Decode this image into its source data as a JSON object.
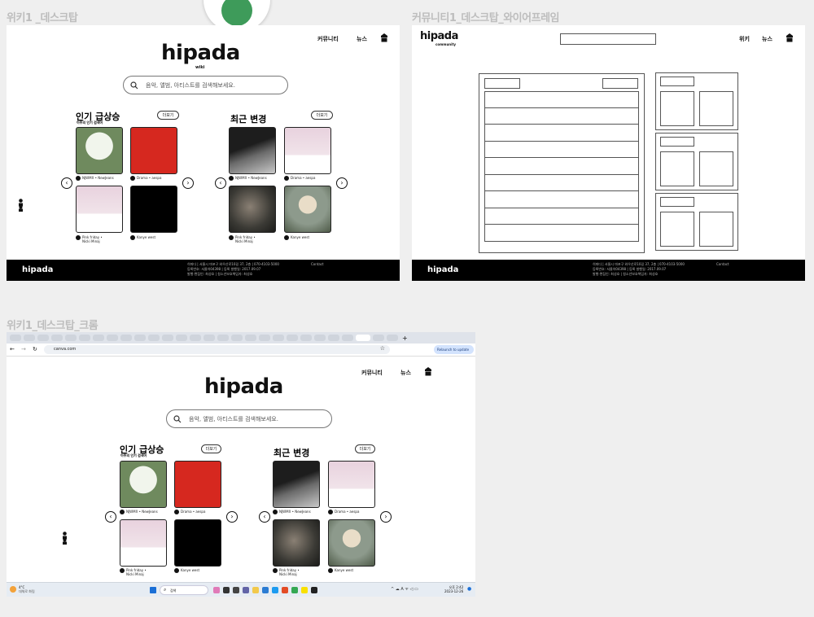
{
  "labels": {
    "wiki_desktop": "위키1 _데스크탑",
    "community_wireframe": "커뮤니티1_데스크탑_와이어프레임",
    "wiki_chrome": "위키1_데스크탑_크롬"
  },
  "wiki": {
    "logo": "hipada",
    "logo_sub": "wiki",
    "nav": {
      "community": "커뮤니티",
      "news": "뉴스"
    },
    "search_placeholder": "음악, 앨범, 아티스트를 검색해보세요.",
    "popular": {
      "title": "인기 급상승",
      "subtitle": "이주의 인기 검색어",
      "more": "더보기"
    },
    "recent": {
      "title": "최근 변경",
      "more": "더보기"
    },
    "popular_items": [
      {
        "caption": "NJWMX • NewJeans",
        "art": "bunny"
      },
      {
        "caption": "Drama • aespa",
        "art": "red"
      },
      {
        "caption": "Pink friday • Nicki Minaj",
        "art": "pink"
      },
      {
        "caption": "Kanye west",
        "art": "black"
      }
    ],
    "recent_items": [
      {
        "caption": "NJWMX • NewJeans",
        "art": "skate"
      },
      {
        "caption": "Drama • aespa",
        "art": "pink"
      },
      {
        "caption": "Pink friday • Nicki Minaj",
        "art": "portrait"
      },
      {
        "caption": "Kanye west",
        "art": "blonde"
      }
    ],
    "footer": {
      "logo": "hipada",
      "line1": "히파다 | 서울시 마포구 와우산로10길 37, 2층 | 070-4103-5000",
      "line2": "등록번호: 서울아04398 | 등록 발행일: 2017.09.07",
      "line3": "발행·편집인: 최성호 | 청소년보호책임자: 최성호",
      "contact": "Contact"
    }
  },
  "community": {
    "logo": "hipada",
    "logo_sub": "community",
    "nav": {
      "wiki": "위키",
      "news": "뉴스"
    },
    "footer": {
      "logo": "hipada",
      "line1": "히파다 | 서울시 마포구 와우산로10길 37, 2층 | 070-4103-5000",
      "line2": "등록번호: 서울아04398 | 등록 발행일: 2017.09.07",
      "line3": "발행·편집인: 최성호 | 청소년보호책임자: 최성호",
      "contact": "Contact"
    }
  },
  "chrome": {
    "url": "canva.com",
    "relaunch": "Relaunch to update",
    "weather_temp": "4°C",
    "weather_desc": "대체로 화림",
    "search_label": "검색",
    "clock_time": "오후 2:42",
    "clock_date": "2023-12-26"
  }
}
